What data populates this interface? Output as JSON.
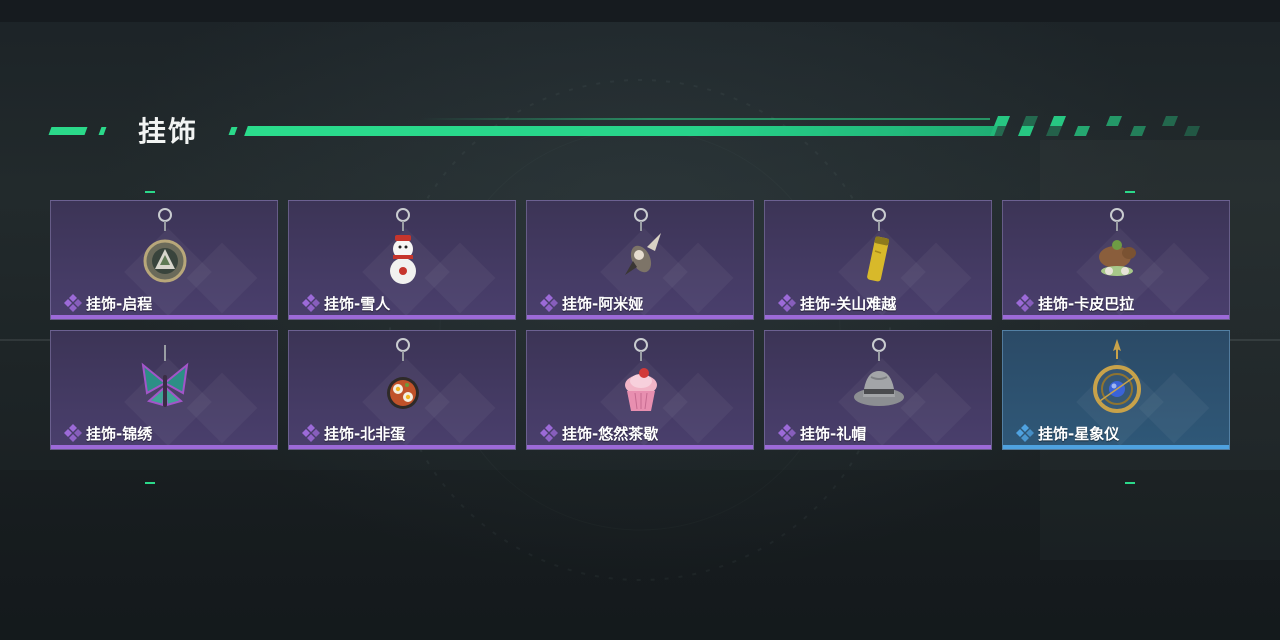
{
  "section": {
    "title": "挂饰"
  },
  "colors": {
    "accent": "#2bd98a",
    "rarity_purple": "#9c6ad8",
    "rarity_blue": "#4fa2e0"
  },
  "items": [
    {
      "label": "挂饰-启程",
      "rarity": "purple",
      "icon": "compass-medallion-charm-icon"
    },
    {
      "label": "挂饰-雪人",
      "rarity": "purple",
      "icon": "snowman-charm-icon"
    },
    {
      "label": "挂饰-阿米娅",
      "rarity": "purple",
      "icon": "amiya-figure-charm-icon"
    },
    {
      "label": "挂饰-关山难越",
      "rarity": "purple",
      "icon": "gold-tube-charm-icon"
    },
    {
      "label": "挂饰-卡皮巴拉",
      "rarity": "purple",
      "icon": "capybara-charm-icon"
    },
    {
      "label": "挂饰-锦绣",
      "rarity": "purple",
      "icon": "butterfly-charm-icon"
    },
    {
      "label": "挂饰-北非蛋",
      "rarity": "purple",
      "icon": "shakshuka-pan-charm-icon"
    },
    {
      "label": "挂饰-悠然茶歇",
      "rarity": "purple",
      "icon": "cupcake-charm-icon"
    },
    {
      "label": "挂饰-礼帽",
      "rarity": "purple",
      "icon": "fedora-hat-charm-icon"
    },
    {
      "label": "挂饰-星象仪",
      "rarity": "blue",
      "icon": "astrolabe-charm-icon"
    }
  ]
}
